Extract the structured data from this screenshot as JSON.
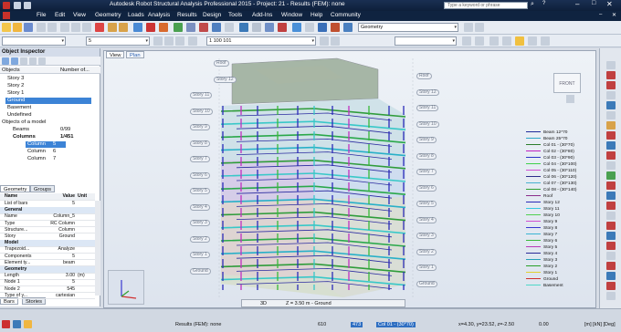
{
  "window": {
    "title": "Autodesk Robot Structural Analysis Professional 2015 - Project: 21 - Results (FEM): none",
    "search_placeholder": "Type a keyword or phrase"
  },
  "menu": [
    "File",
    "Edit",
    "View",
    "Geometry",
    "Loads",
    "Analysis",
    "Results",
    "Design",
    "Tools",
    "Add-Ins",
    "Window",
    "Help",
    "Community"
  ],
  "toolbar": {
    "combo_a": "",
    "combo_b": "5",
    "combo_c": "1 100 101",
    "combo_geometry": "Geometry"
  },
  "object_inspector": {
    "title": "Object Inspector",
    "col_objects": "Objects",
    "col_number": "Number of...",
    "items": [
      "Story 3",
      "Story 2",
      "Story 1",
      "Ground",
      "Basement",
      "Undefined",
      "Objects of a model",
      "Beams",
      "Columns",
      "Column",
      "Column",
      "Column"
    ],
    "beams_count": "0/99",
    "columns_count": "1/451",
    "col_idx": [
      "5",
      "6",
      "7"
    ]
  },
  "geometry_panel": {
    "tabs": [
      "Geometry",
      "Groups"
    ],
    "headers": [
      "Name",
      "Value",
      "Unit"
    ],
    "rows": [
      {
        "name": "List of bars",
        "value": "5",
        "unit": "",
        "group": false
      },
      {
        "name": "General",
        "value": "",
        "unit": "",
        "group": true
      },
      {
        "name": "Name",
        "value": "Column_5",
        "unit": "",
        "group": false
      },
      {
        "name": "Type",
        "value": "RC Column",
        "unit": "",
        "group": false
      },
      {
        "name": "Structure...",
        "value": "Column",
        "unit": "",
        "group": false
      },
      {
        "name": "Story",
        "value": "Ground",
        "unit": "",
        "group": false
      },
      {
        "name": "Model",
        "value": "",
        "unit": "",
        "group": true
      },
      {
        "name": "Trapezoid...",
        "value": "Analyze",
        "unit": "",
        "group": false
      },
      {
        "name": "Components",
        "value": "5",
        "unit": "",
        "group": false
      },
      {
        "name": "Element ty...",
        "value": "beam",
        "unit": "",
        "group": false
      },
      {
        "name": "Geometry",
        "value": "",
        "unit": "",
        "group": true
      },
      {
        "name": "Length",
        "value": "3.00",
        "unit": "(m)",
        "group": false
      },
      {
        "name": "Node 1",
        "value": "5",
        "unit": "",
        "group": false
      },
      {
        "name": "Node 2",
        "value": "545",
        "unit": "",
        "group": false
      },
      {
        "name": "Type of y...",
        "value": "cartesian",
        "unit": "",
        "group": false
      }
    ],
    "bottom_tabs": [
      "Bars",
      "Stories"
    ]
  },
  "view": {
    "tabs": [
      "View",
      "Plan"
    ],
    "left_story_tags": [
      "Roof",
      "Story 12",
      "Story 11",
      "Story 10",
      "Story 9",
      "Story 8",
      "Story 7",
      "Story 6",
      "Story 5",
      "Story 4",
      "Story 3",
      "Story 2",
      "Story 1",
      "Ground"
    ],
    "right_story_tags": [
      "Roof",
      "Story 12",
      "Story 11",
      "Story 10",
      "Story 9",
      "Story 8",
      "Story 7",
      "Story 6",
      "Story 5",
      "Story 4",
      "Story 3",
      "Story 2",
      "Story 1",
      "Ground"
    ],
    "viewcube_label": "FRONT",
    "bottom_label_left": "3D",
    "bottom_label": "Z = 3.50 m - Ground",
    "legend": [
      {
        "label": "Beam 12*70",
        "color": "#1e2a9a"
      },
      {
        "label": "Beam 25*70",
        "color": "#2fa8c8"
      },
      {
        "label": "Col 01 - (30*70)",
        "color": "#2b7d2b"
      },
      {
        "label": "Col 02 - (30*80)",
        "color": "#c021c0"
      },
      {
        "label": "Col 03 - (30*90)",
        "color": "#2d35c8"
      },
      {
        "label": "Col 04 - (30*100)",
        "color": "#3fd04a"
      },
      {
        "label": "Col 05 - (30*110)",
        "color": "#d24fd2"
      },
      {
        "label": "Col 06 - (30*120)",
        "color": "#2c2c8a"
      },
      {
        "label": "Col 07 - (30*130)",
        "color": "#48b0d0"
      },
      {
        "label": "Col 08 - (30*140)",
        "color": "#30a030"
      },
      {
        "label": "Roof",
        "color": "#8a2c8a"
      },
      {
        "label": "Story 12",
        "color": "#2a2ab8"
      },
      {
        "label": "Story 11",
        "color": "#38c8e0"
      },
      {
        "label": "Story 10",
        "color": "#50d050"
      },
      {
        "label": "Story 9",
        "color": "#d050d0"
      },
      {
        "label": "Story 8",
        "color": "#3838d0"
      },
      {
        "label": "Story 7",
        "color": "#3ab4d4"
      },
      {
        "label": "Story 6",
        "color": "#38b838"
      },
      {
        "label": "Story 5",
        "color": "#b838b8"
      },
      {
        "label": "Story 4",
        "color": "#2a2a98"
      },
      {
        "label": "Story 3",
        "color": "#28a0b8"
      },
      {
        "label": "Story 2",
        "color": "#28a028"
      },
      {
        "label": "Story 1",
        "color": "#e0d030"
      },
      {
        "label": "Ground",
        "color": "#d03030"
      },
      {
        "label": "Basement",
        "color": "#50d8c8"
      }
    ]
  },
  "status": {
    "results": "Results (FEM): none",
    "num1": "610",
    "num2": "473",
    "col_sel": "Col 01 - (30*70)",
    "coords": "x=4.30, y=23.52, z=-2.50",
    "angle": "0.00",
    "units": "[m] [kN] [Deg]"
  }
}
